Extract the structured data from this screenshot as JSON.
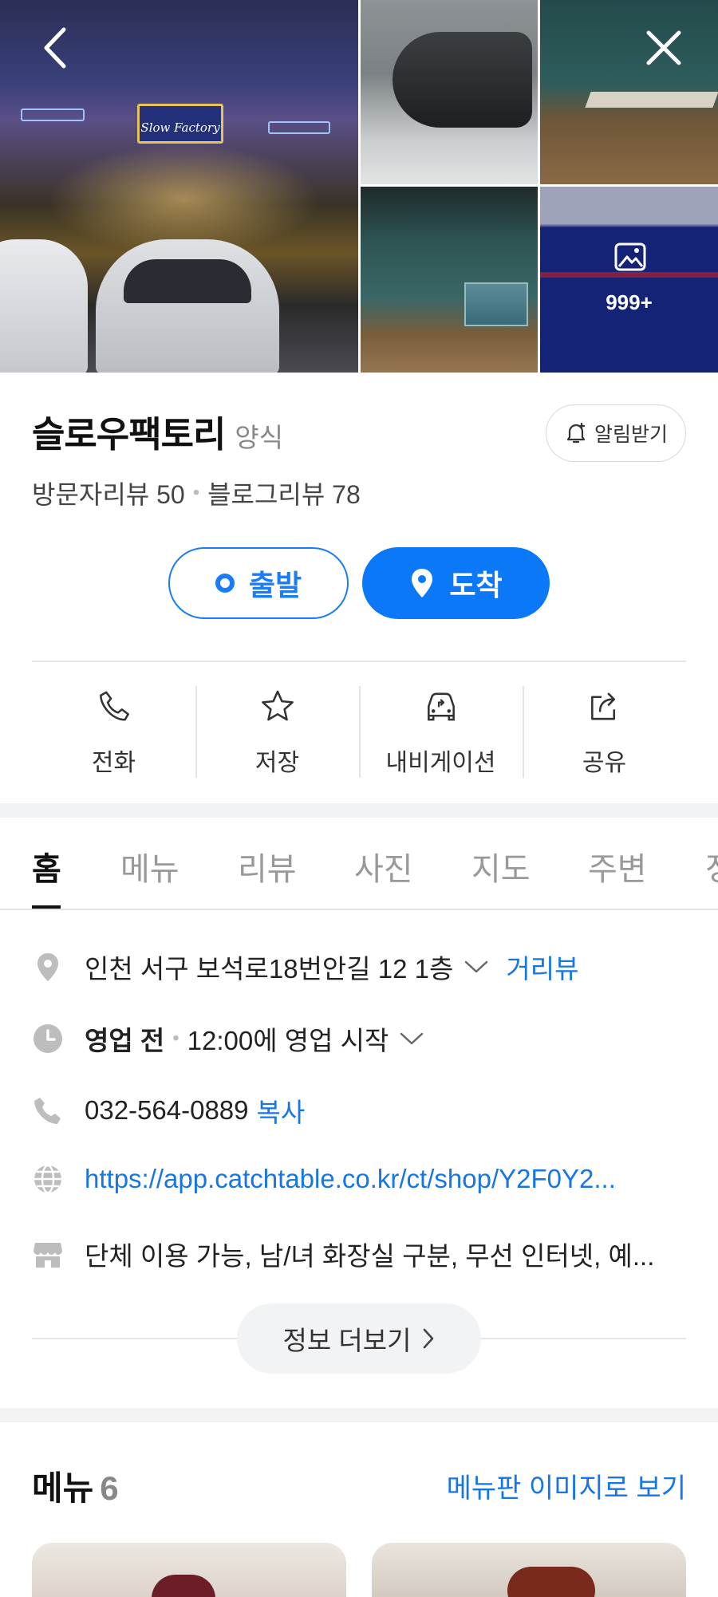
{
  "gallery": {
    "main_sign": "Slow Factory",
    "more_count": "999+"
  },
  "place": {
    "name": "슬로우팩토리",
    "category": "양식",
    "alarm_label": "알림받기",
    "visitor_reviews": "방문자리뷰 50",
    "blog_reviews": "블로그리뷰 78"
  },
  "route": {
    "start_label": "출발",
    "end_label": "도착",
    "accent": "#0b79f7"
  },
  "actions": [
    {
      "label": "전화",
      "icon": "phone-icon"
    },
    {
      "label": "저장",
      "icon": "star-icon"
    },
    {
      "label": "내비게이션",
      "icon": "car-icon"
    },
    {
      "label": "공유",
      "icon": "share-icon"
    }
  ],
  "tabs": [
    "홈",
    "메뉴",
    "리뷰",
    "사진",
    "지도",
    "주변",
    "정"
  ],
  "details": {
    "address": "인천 서구 보석로18번안길 12 1층",
    "street_view": "거리뷰",
    "status": "영업 전",
    "hours": "12:00에 영업 시작",
    "phone": "032-564-0889",
    "copy": "복사",
    "website": "https://app.catchtable.co.kr/ct/shop/Y2F0Y2...",
    "amenities": "단체 이용 가능, 남/녀 화장실 구분, 무선 인터넷, 예..."
  },
  "more_info_label": "정보 더보기",
  "menu": {
    "title": "메뉴",
    "count": "6",
    "view_board": "메뉴판 이미지로 보기"
  }
}
